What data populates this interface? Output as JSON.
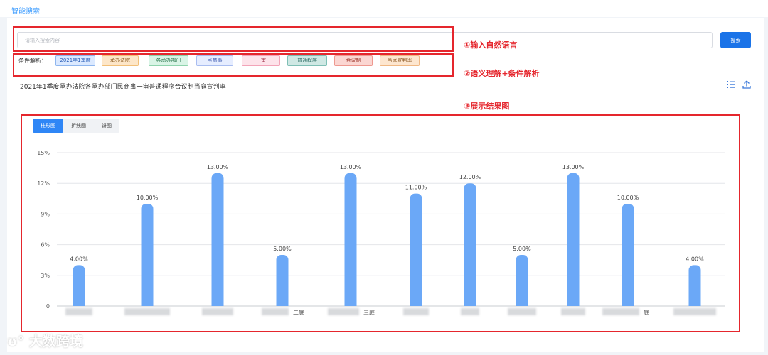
{
  "header": {
    "title": "智能搜索"
  },
  "search": {
    "placeholder": "请输入搜索内容",
    "value": "",
    "button_label": "搜索"
  },
  "annotations": {
    "step1": "①输入自然语言",
    "step2": "②语义理解+条件解析",
    "step3": "③展示结果图"
  },
  "conditions": {
    "label": "条件解析：",
    "chips": [
      {
        "text": "2021年1季度",
        "bg": "#dbe9ff",
        "border": "#8fb6ee",
        "color": "#2b5fb8"
      },
      {
        "text": "承办法院",
        "bg": "#fde6c8",
        "border": "#f2bf78",
        "color": "#8a5a1f"
      },
      {
        "text": "各承办部门",
        "bg": "#d9f4e6",
        "border": "#8fd3ad",
        "color": "#2f7a52"
      },
      {
        "text": "民商事",
        "bg": "#e6edff",
        "border": "#a9bdf0",
        "color": "#3d5ab0"
      },
      {
        "text": "一审",
        "bg": "#fde3ea",
        "border": "#f2a4b8",
        "color": "#a4364f"
      },
      {
        "text": "普通程序",
        "bg": "#cfe8e4",
        "border": "#7fbfb5",
        "color": "#2f6e66"
      },
      {
        "text": "合议制",
        "bg": "#fbd6d2",
        "border": "#ee9990",
        "color": "#a03a30"
      },
      {
        "text": "当庭宣判率",
        "bg": "#fde6cf",
        "border": "#f0b884",
        "color": "#8e5a25"
      }
    ]
  },
  "query_summary": "2021年1季度承办法院各承办部门民商事一审普通程序合议制当庭宣判率",
  "toolbar": {
    "list_icon": "list-icon",
    "export_icon": "upload-icon"
  },
  "tabs": [
    {
      "label": "柱形图",
      "active": true
    },
    {
      "label": "折线图",
      "active": false
    },
    {
      "label": "饼图",
      "active": false
    }
  ],
  "chart_data": {
    "type": "bar",
    "categories": [
      "",
      "",
      "",
      "二庭",
      "三庭",
      "",
      "",
      "",
      "",
      "庭",
      ""
    ],
    "values": [
      4.0,
      10.0,
      13.0,
      5.0,
      13.0,
      11.0,
      12.0,
      5.0,
      13.0,
      10.0,
      4.0
    ],
    "data_labels": [
      "4.00%",
      "10.00%",
      "13.00%",
      "5.00%",
      "13.00%",
      "11.00%",
      "12.00%",
      "5.00%",
      "13.00%",
      "10.00%",
      "4.00%"
    ],
    "yticks": [
      "0",
      "3%",
      "6%",
      "9%",
      "12%",
      "15%"
    ],
    "ylim": [
      0,
      15
    ],
    "grid": true,
    "bar_color": "#6ba8f7",
    "title": "",
    "xlabel": "",
    "ylabel": ""
  },
  "watermark": "大数跨境",
  "colors": {
    "accent": "#1a73e8",
    "annotation": "#e5262d"
  }
}
